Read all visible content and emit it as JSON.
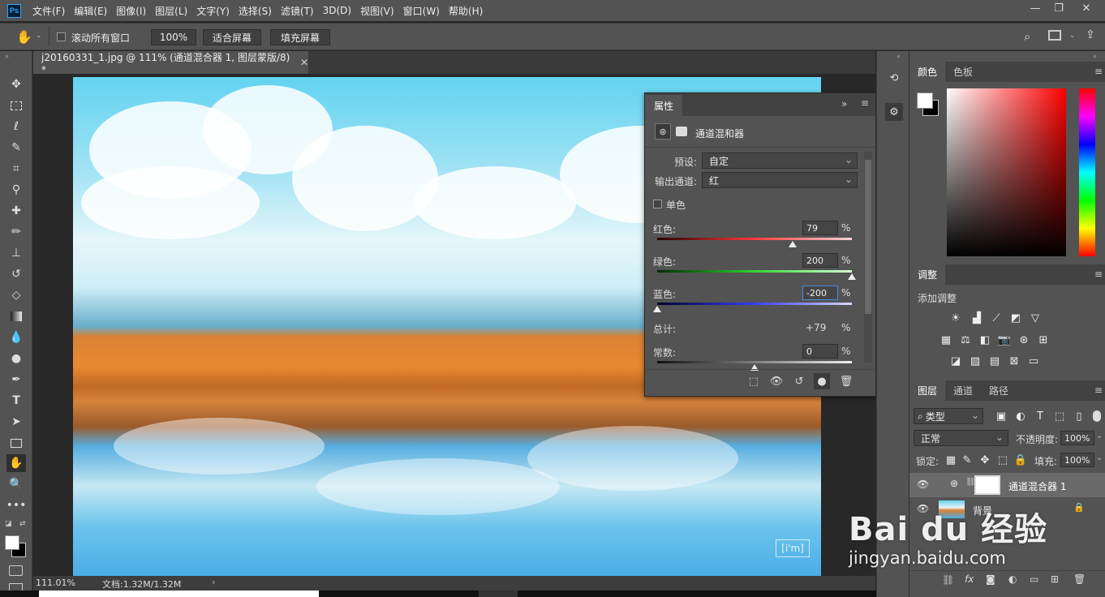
{
  "app": {
    "logo": "Ps"
  },
  "menu": [
    "文件(F)",
    "编辑(E)",
    "图像(I)",
    "图层(L)",
    "文字(Y)",
    "选择(S)",
    "滤镜(T)",
    "3D(D)",
    "视图(V)",
    "窗口(W)",
    "帮助(H)"
  ],
  "options": {
    "scroll_all": "滚动所有窗口",
    "zoom": "100%",
    "fit_screen": "适合屏幕",
    "fill_screen": "填充屏幕"
  },
  "document": {
    "tab_title": "j20160331_1.jpg @ 111% (通道混合器 1, 图层蒙版/8) *",
    "zoom": "111.01%",
    "doc_size": "文档:1.32M/1.32M"
  },
  "properties": {
    "panel_title": "属性",
    "adjustment_name": "通道混和器",
    "preset_label": "预设:",
    "preset_value": "自定",
    "output_label": "输出通道:",
    "output_value": "红",
    "mono_label": "单色",
    "red_label": "红色:",
    "red_value": "79",
    "green_label": "绿色:",
    "green_value": "200",
    "blue_label": "蓝色:",
    "blue_value": "-200",
    "total_label": "总计:",
    "total_value": "+79",
    "constant_label": "常数:",
    "constant_value": "0",
    "pct": "%",
    "red_level": 79,
    "green_level": 200,
    "blue_level": -200,
    "constant_level": 0
  },
  "color_panel": {
    "tab_color": "颜色",
    "tab_swatches": "色板"
  },
  "adjust_panel": {
    "tab": "调整",
    "add_label": "添加调整"
  },
  "layers_panel": {
    "tab_layers": "图层",
    "tab_channels": "通道",
    "tab_paths": "路径",
    "filter_kind": "类型",
    "blend_mode": "正常",
    "opacity_label": "不透明度:",
    "opacity_value": "100%",
    "lock_label": "锁定:",
    "fill_label": "填充:",
    "fill_value": "100%",
    "layers": [
      {
        "name": "通道混合器 1"
      },
      {
        "name": "背景"
      }
    ],
    "footer_fx": "fx"
  },
  "watermark": {
    "brand": "Bai du 经验",
    "url": "jingyan.baidu.com"
  },
  "photo_mark": "[i'm]",
  "colors": {
    "accent": "#31a8ff",
    "panel": "#535353",
    "dark": "#282828"
  }
}
